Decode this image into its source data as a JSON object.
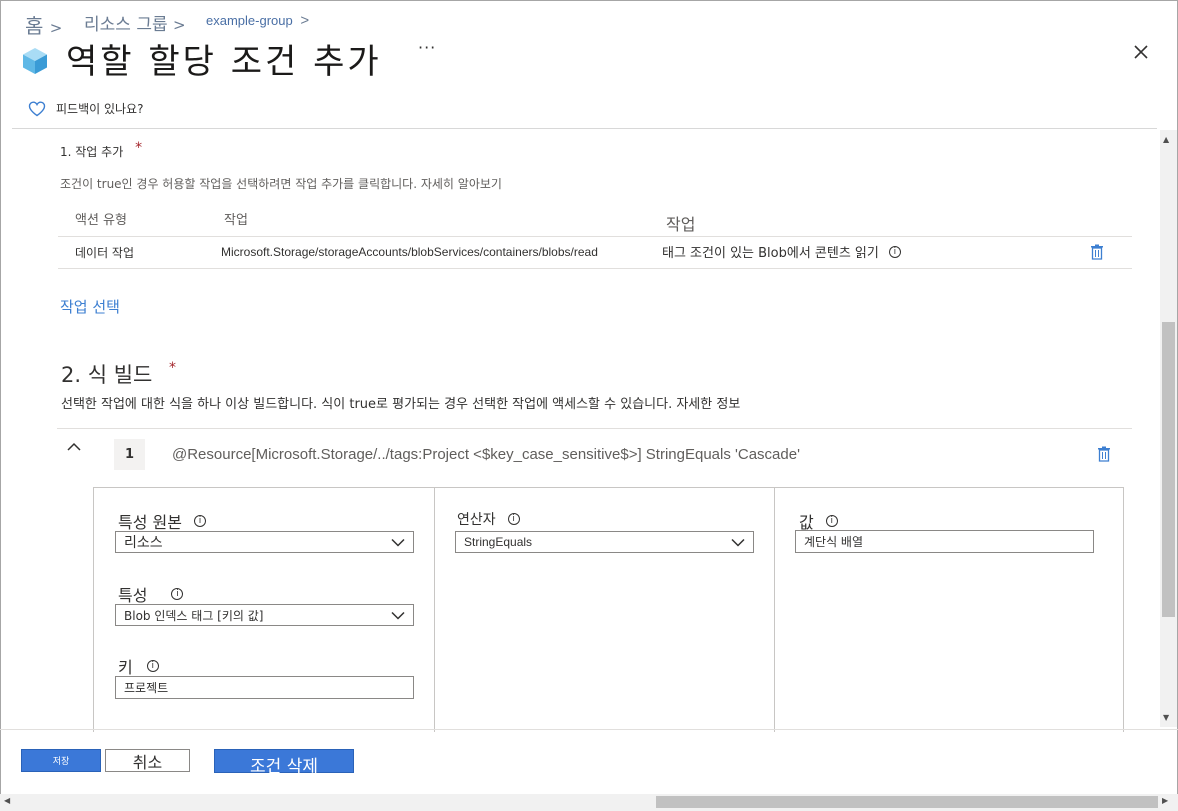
{
  "breadcrumb": {
    "home": "홈",
    "separator": ">",
    "resource_groups": "리소스 그룹",
    "group": "example-group"
  },
  "header": {
    "title": "역할 할당 조건 추가",
    "more": "···"
  },
  "feedback": {
    "label": "피드백이 있나요?"
  },
  "section1": {
    "title": "1. 작업 추가",
    "required": "*",
    "description": "조건이 true인 경우 허용할 작업을 선택하려면 작업 추가를 클릭합니다. 자세히 알아보기",
    "headers": [
      "액션 유형",
      "작업",
      "작업"
    ],
    "row": {
      "type": "데이터 작업",
      "operation": "Microsoft.Storage/storageAccounts/blobServices/containers/blobs/read",
      "description": "태그 조건이 있는 Blob에서 콘텐츠 읽기"
    },
    "select_link": "작업 선택"
  },
  "section2": {
    "title": "2. 식 빌드",
    "required": "*",
    "description": "선택한 작업에 대한 식을 하나 이상 빌드합니다. 식이 true로 평가되는 경우 선택한 작업에 액세스할 수 있습니다. 자세한 정보",
    "expression": {
      "number": "1",
      "text": "@Resource[Microsoft.Storage/../tags:Project  <$key_case_sensitive$>]  StringEquals  'Cascade'",
      "attribute_source": {
        "label": "특성 원본",
        "value": "리소스"
      },
      "attribute": {
        "label": "특성",
        "value": "Blob 인덱스 태그 [키의 값]"
      },
      "key": {
        "label": "키",
        "value": "프로젝트"
      },
      "operator": {
        "label": "연산자",
        "value": "StringEquals"
      },
      "value": {
        "label": "값",
        "value": "계단식 배열"
      }
    }
  },
  "footer": {
    "save": "저장",
    "cancel": "취소",
    "delete_condition": "조건 삭제"
  },
  "colors": {
    "link": "#3d7fd1",
    "primary": "#3b78d8",
    "required": "#a4262c",
    "trash": "#3d7fd1"
  }
}
